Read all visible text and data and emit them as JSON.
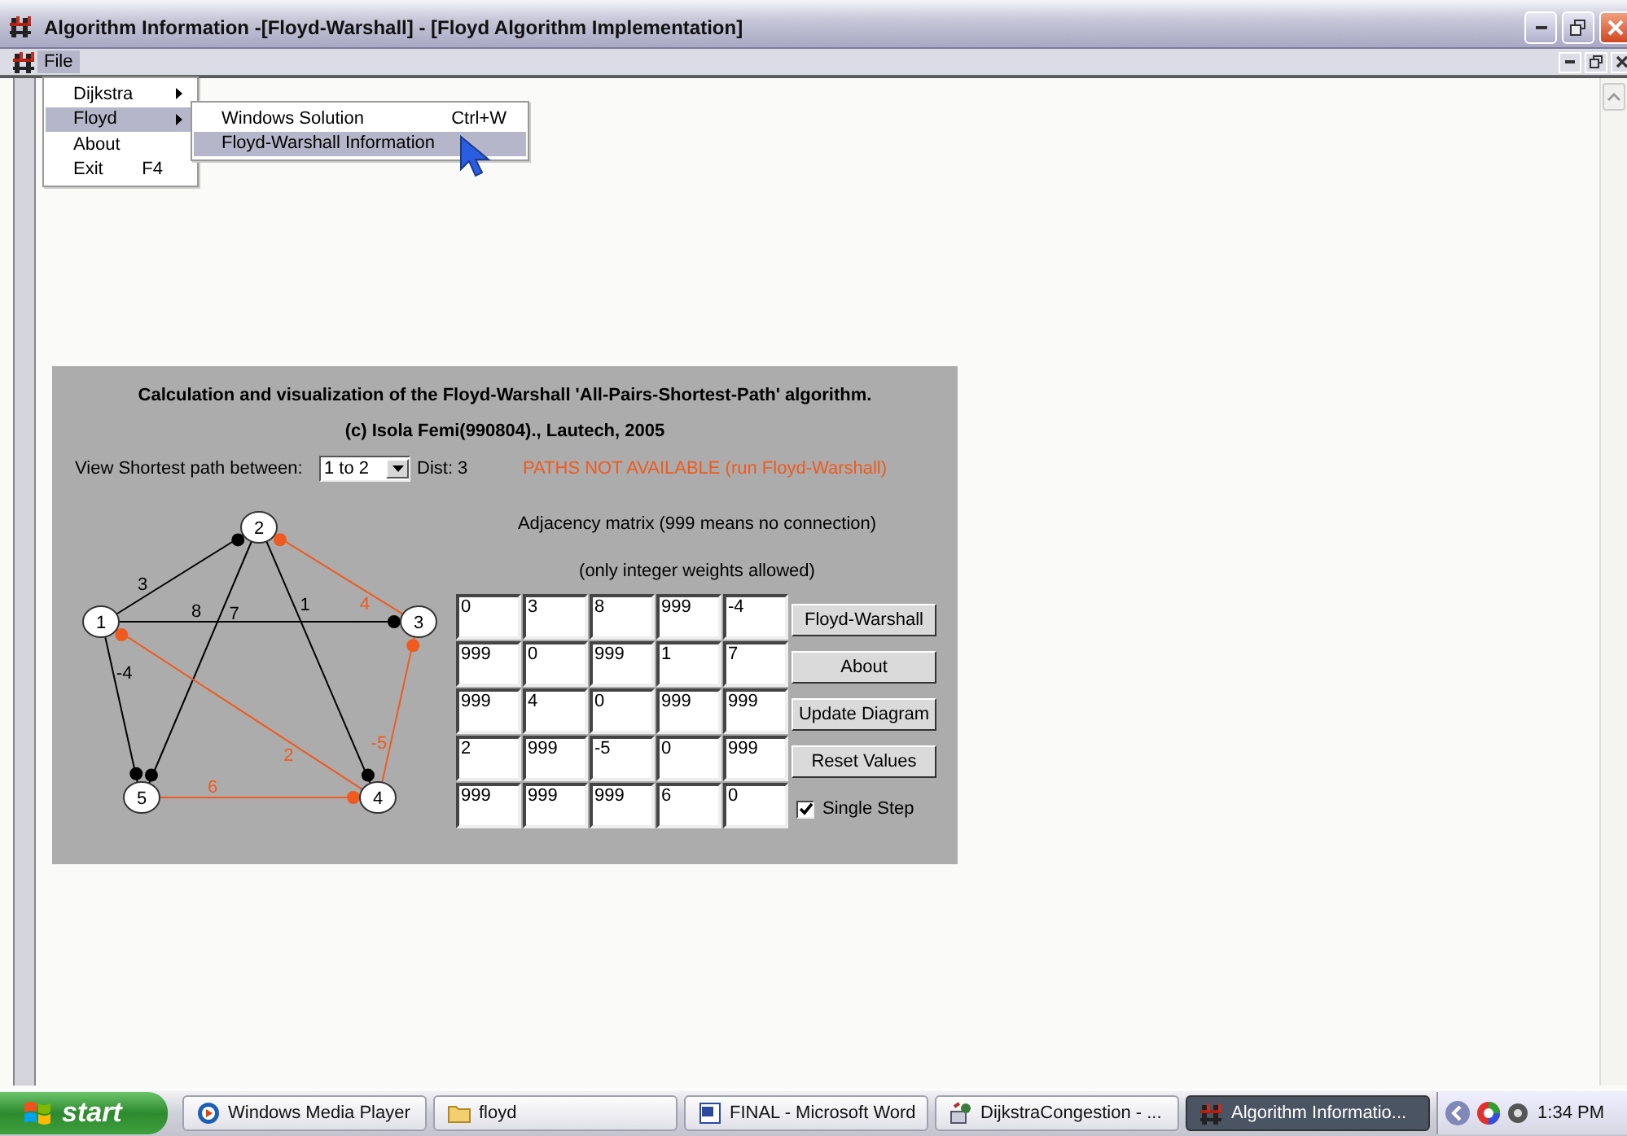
{
  "window": {
    "title": "Algorithm Information -[Floyd-Warshall] - [Floyd Algorithm Implementation]"
  },
  "menu_bar": {
    "items": [
      {
        "label": "File",
        "selected": true
      }
    ]
  },
  "file_menu": {
    "items": [
      {
        "label": "Dijkstra",
        "submenu": true,
        "selected": false
      },
      {
        "label": "Floyd",
        "submenu": true,
        "selected": true
      },
      {
        "label": "About",
        "submenu": false,
        "selected": false
      },
      {
        "label": "Exit",
        "shortcut": "F4",
        "submenu": false,
        "selected": false
      }
    ]
  },
  "floyd_submenu": {
    "items": [
      {
        "label": "Windows Solution",
        "shortcut": "Ctrl+W",
        "selected": false
      },
      {
        "label": "Floyd-Warshall Information",
        "selected": true
      }
    ]
  },
  "panel": {
    "heading": "Calculation and visualization of the Floyd-Warshall 'All-Pairs-Shortest-Path' algorithm.",
    "credit": "(c)  Isola Femi(990804)., Lautech, 2005",
    "path_label": "View Shortest path between:",
    "path_select": {
      "value": "1 to 2"
    },
    "distance": "Dist: 3",
    "status": "PATHS NOT AVAILABLE (run Floyd-Warshall)",
    "graph": {
      "nodes": [
        "1",
        "2",
        "3",
        "4",
        "5"
      ],
      "edges": [
        {
          "weight": "3",
          "color": "#000000"
        },
        {
          "weight": "8",
          "color": "#000000"
        },
        {
          "weight": "-4",
          "color": "#000000"
        },
        {
          "weight": "1",
          "color": "#000000"
        },
        {
          "weight": "7",
          "color": "#000000"
        },
        {
          "weight": "4",
          "color": "#f05a1e"
        },
        {
          "weight": "2",
          "color": "#f05a1e"
        },
        {
          "weight": "-5",
          "color": "#f05a1e"
        },
        {
          "weight": "6",
          "color": "#f05a1e"
        }
      ]
    },
    "matrix_caption": "Adjacency matrix (999 means no connection)",
    "matrix_note": "(only integer weights allowed)",
    "matrix": [
      [
        "0",
        "3",
        "8",
        "999",
        "-4"
      ],
      [
        "999",
        "0",
        "999",
        "1",
        "7"
      ],
      [
        "999",
        "4",
        "0",
        "999",
        "999"
      ],
      [
        "2",
        "999",
        "-5",
        "0",
        "999"
      ],
      [
        "999",
        "999",
        "999",
        "6",
        "0"
      ]
    ],
    "buttons": [
      "Floyd-Warshall",
      "About",
      "Update Diagram",
      "Reset Values"
    ],
    "single_step": {
      "label": "Single Step",
      "checked": true
    }
  },
  "taskbar": {
    "start": "start",
    "tasks": [
      {
        "label": "Windows Media Player",
        "selected": false
      },
      {
        "label": "floyd",
        "selected": false
      },
      {
        "label": "FINAL - Microsoft Word",
        "selected": false
      },
      {
        "label": "DijkstraCongestion - ...",
        "selected": false
      },
      {
        "label": "Algorithm Informatio...",
        "selected": true
      }
    ],
    "clock": "1:34 PM"
  }
}
